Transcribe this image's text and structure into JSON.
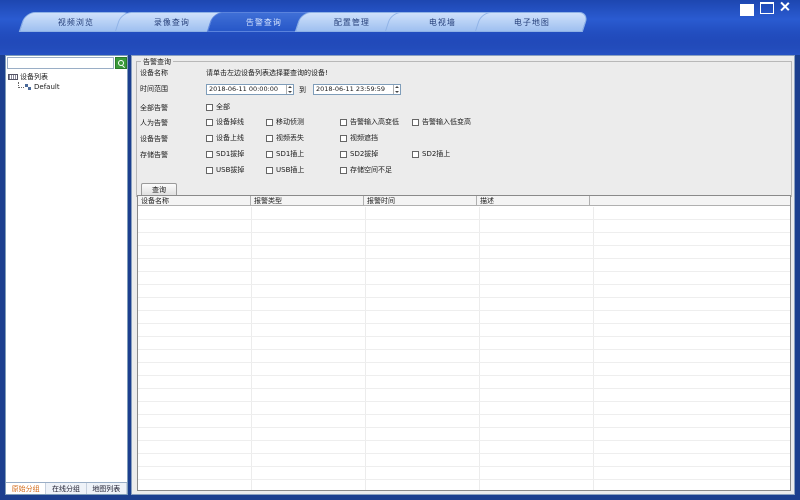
{
  "tabs": [
    {
      "label": "视频浏览",
      "active": false
    },
    {
      "label": "录像查询",
      "active": false
    },
    {
      "label": "告警查询",
      "active": true
    },
    {
      "label": "配置管理",
      "active": false
    },
    {
      "label": "电视墙",
      "active": false
    },
    {
      "label": "电子地图",
      "active": false
    }
  ],
  "sidebar": {
    "search_value": "",
    "tree_root": "设备列表",
    "tree_child": "Default",
    "bottom_tabs": [
      "原始分组",
      "在线分组",
      "地图列表"
    ],
    "active_bottom_tab": 0
  },
  "alarm_query": {
    "group_title": "告警查询",
    "device_name_label": "设备名称",
    "device_hint": "请单击左边设备列表选择要查询的设备!",
    "time_range_label": "时间范围",
    "start_time": "2018-06-11   00:00:00",
    "to_label": "到",
    "end_time": "2018-06-11   23:59:59",
    "all_alarm_label": "全部告警",
    "all_option": "全部",
    "manual_alarm_label": "人为告警",
    "manual_options": [
      "设备掉线",
      "移动侦测",
      "告警输入高变低",
      "告警输入低变高"
    ],
    "device_alarm_label": "设备告警",
    "device_options": [
      "设备上线",
      "视频丢失",
      "视频遮挡"
    ],
    "storage_alarm_label": "存储告警",
    "storage_options_row1": [
      "SD1拔掉",
      "SD1插上",
      "SD2拔掉",
      "SD2插上"
    ],
    "storage_options_row2": [
      "USB拔掉",
      "USB插上",
      "存储空间不足"
    ],
    "query_button": "查询"
  },
  "results_table": {
    "columns": [
      "设备名称",
      "报警类型",
      "报警时间",
      "描述"
    ],
    "rows": []
  }
}
